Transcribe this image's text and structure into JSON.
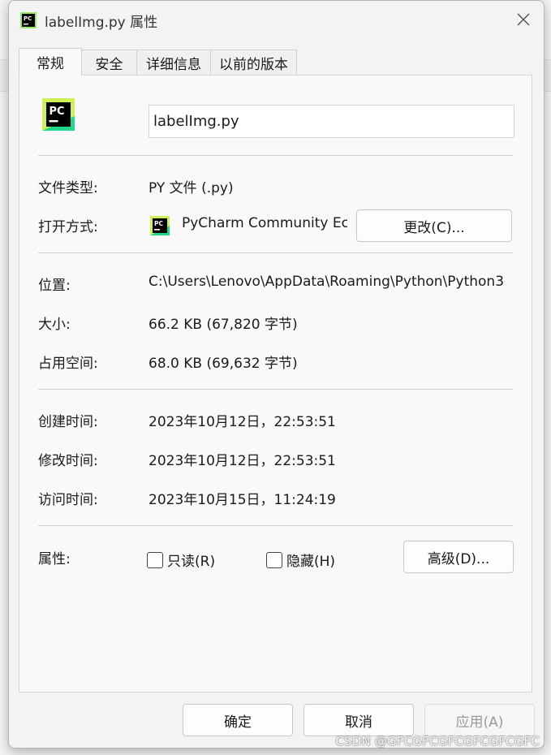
{
  "dialog": {
    "title": "labelImg.py 属性",
    "icon": "pycharm-icon",
    "close_icon": "close-icon"
  },
  "tabs": [
    {
      "label": "常规"
    },
    {
      "label": "安全"
    },
    {
      "label": "详细信息"
    },
    {
      "label": "以前的版本"
    }
  ],
  "general": {
    "filename": "labelImg.py",
    "file_type_label": "文件类型:",
    "file_type_value": "PY 文件 (.py)",
    "opens_with_label": "打开方式:",
    "opens_with_value": "PyCharm Community Ec",
    "change_button": "更改(C)...",
    "location_label": "位置:",
    "location_value": "C:\\Users\\Lenovo\\AppData\\Roaming\\Python\\Python3",
    "size_label": "大小:",
    "size_value": "66.2 KB (67,820 字节)",
    "size_on_disk_label": "占用空间:",
    "size_on_disk_value": "68.0 KB (69,632 字节)",
    "created_label": "创建时间:",
    "created_value": "2023年10月12日，22:53:51",
    "modified_label": "修改时间:",
    "modified_value": "2023年10月12日，22:53:51",
    "accessed_label": "访问时间:",
    "accessed_value": "2023年10月15日，11:24:19",
    "attributes_label": "属性:",
    "readonly_label": "只读(R)",
    "hidden_label": "隐藏(H)",
    "advanced_button": "高级(D)..."
  },
  "footer": {
    "ok": "确定",
    "cancel": "取消",
    "apply": "应用(A)"
  },
  "watermark": "CSDN @GFCGFCGFCGFCGFCGFC",
  "colors": {
    "pycharm_green": "#21d789",
    "pycharm_yellow": "#fcf84a",
    "pycharm_black": "#000000"
  }
}
